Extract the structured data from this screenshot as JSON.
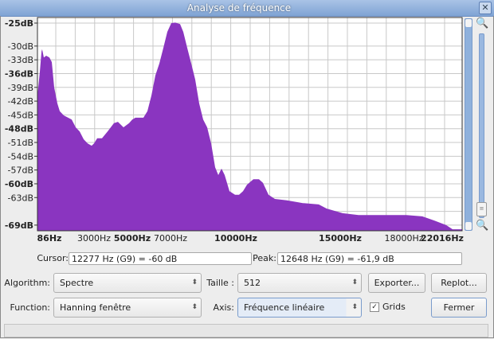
{
  "window": {
    "title": "Analyse de fréquence",
    "close_icon": "close-icon"
  },
  "controls": {
    "cursor_label": "Cursor:",
    "cursor_value": "12277 Hz (G9) = -60 dB",
    "peak_label": "Peak:",
    "peak_value": "12648 Hz (G9) = -61,9 dB",
    "algorithm_label": "Algorithm:",
    "algorithm_value": "Spectre",
    "size_label": "Taille :",
    "size_value": "512",
    "export_button": "Exporter...",
    "replot_button": "Replot...",
    "function_label": "Function:",
    "function_value": "Hanning fenêtre",
    "axis_label": "Axis:",
    "axis_value": "Fréquence linéaire",
    "grids_label": "Grids",
    "grids_checked": true,
    "close_button": "Fermer"
  },
  "colors": {
    "fill": "#8a35c0",
    "grid": "#c8c8c8"
  },
  "chart_data": {
    "type": "area",
    "xlabel": "",
    "ylabel": "",
    "y_ticks": [
      {
        "v": -25,
        "label": "-25dB",
        "bold": true
      },
      {
        "v": -30,
        "label": "-30dB"
      },
      {
        "v": -33,
        "label": "-33dB"
      },
      {
        "v": -36,
        "label": "-36dB",
        "bold": true
      },
      {
        "v": -39,
        "label": "-39dB"
      },
      {
        "v": -42,
        "label": "-42dB"
      },
      {
        "v": -45,
        "label": "-45dB"
      },
      {
        "v": -48,
        "label": "-48dB",
        "bold": true
      },
      {
        "v": -51,
        "label": "-51dB"
      },
      {
        "v": -54,
        "label": "-54dB"
      },
      {
        "v": -57,
        "label": "-57dB"
      },
      {
        "v": -60,
        "label": "-60dB",
        "bold": true
      },
      {
        "v": -63,
        "label": "-63dB"
      },
      {
        "v": -69,
        "label": "-69dB",
        "bold": true
      }
    ],
    "x_ticks": [
      {
        "v": 86,
        "label": "86Hz",
        "bold": true
      },
      {
        "v": 3000,
        "label": "3000Hz"
      },
      {
        "v": 5000,
        "label": "5000Hz",
        "bold": true
      },
      {
        "v": 7000,
        "label": "7000Hz"
      },
      {
        "v": 10000,
        "label": "10000Hz",
        "bold": true
      },
      {
        "v": 15000,
        "label": "15000Hz",
        "bold": true
      },
      {
        "v": 18000,
        "label": "18000Hz"
      },
      {
        "v": 22016,
        "label": "22016Hz",
        "bold": true
      }
    ],
    "ylim": [
      -70,
      -24
    ],
    "grid": true,
    "hz": [
      0,
      17,
      29,
      34,
      46,
      63,
      86,
      242,
      398,
      606,
      763,
      1023,
      1543,
      1803,
      2064,
      2324,
      2584,
      2844,
      3000,
      3167,
      3417,
      3709,
      4042,
      4250,
      4542,
      4833,
      5000,
      5167,
      5583,
      5792,
      6000,
      6208,
      6417,
      6625,
      6833,
      7037,
      7220,
      7439,
      7585,
      7768,
      7951,
      8134,
      8317,
      8500,
      8683,
      8866,
      9049,
      9195,
      9341,
      9488,
      9707,
      9963,
      10153,
      10344,
      10535,
      10840,
      11107,
      11298,
      11565,
      11870,
      12443,
      13206,
      13970,
      14351,
      14733,
      15113,
      15863,
      17363,
      18251,
      19925,
      21181,
      22435,
      23100,
      24100
    ],
    "db": [
      -40.8,
      -35.6,
      -31.2,
      -30.7,
      -32.5,
      -32.1,
      -32.5,
      -33.5,
      -39,
      -42.5,
      -44.2,
      -45.1,
      -46,
      -47.7,
      -48.6,
      -50.3,
      -51.2,
      -51.7,
      -51.2,
      -50.1,
      -50.1,
      -48.6,
      -46.8,
      -46.5,
      -47.7,
      -46.8,
      -46,
      -45.6,
      -45.6,
      -44.2,
      -40.8,
      -36.4,
      -33.8,
      -30.4,
      -26.9,
      -25,
      -24.9,
      -25.2,
      -26.9,
      -30.4,
      -33.8,
      -37.3,
      -42.5,
      -46,
      -47.7,
      -51.2,
      -56.4,
      -58.1,
      -56.7,
      -58.1,
      -61.6,
      -62.4,
      -62.4,
      -61.6,
      -60.2,
      -59,
      -59,
      -59.8,
      -62.4,
      -63.3,
      -63.6,
      -64.2,
      -64.5,
      -65.4,
      -65.9,
      -66.4,
      -66.8,
      -66.8,
      -66.8,
      -67.1,
      -68,
      -69,
      -69.9,
      -69.9
    ]
  }
}
